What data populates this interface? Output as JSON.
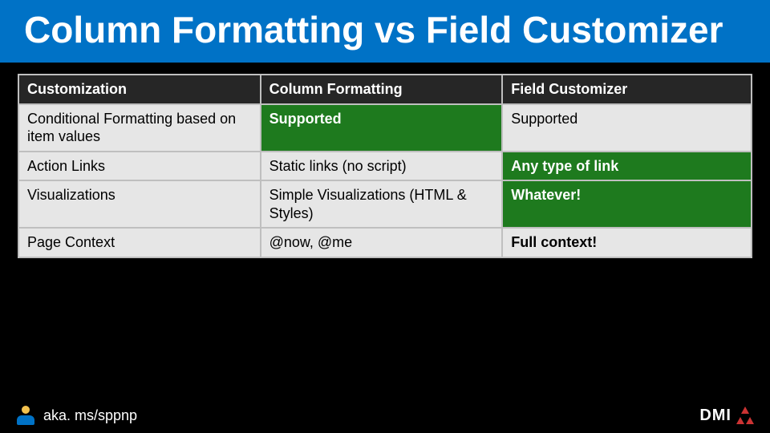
{
  "title": "Column Formatting vs Field Customizer",
  "table": {
    "headers": [
      "Customization",
      "Column Formatting",
      "Field Customizer"
    ],
    "rows": [
      {
        "label": "Conditional Formatting based on item values",
        "col1": "Supported",
        "col2": "Supported"
      },
      {
        "label": "Action Links",
        "col1": "Static links (no script)",
        "col2": "Any type of link"
      },
      {
        "label": "Visualizations",
        "col1": "Simple Visualizations (HTML & Styles)",
        "col2": "Whatever!"
      },
      {
        "label": "Page Context",
        "col1": "@now, @me",
        "col2": "Full context!"
      }
    ]
  },
  "footer": {
    "link": "aka. ms/sppnp",
    "brand": "DMI"
  },
  "colors": {
    "title_bg": "#0072c6",
    "header_bg": "#262626",
    "cell_bg": "#e6e6e6",
    "highlight_bg": "#1e7a1e",
    "page_bg": "#000000"
  }
}
